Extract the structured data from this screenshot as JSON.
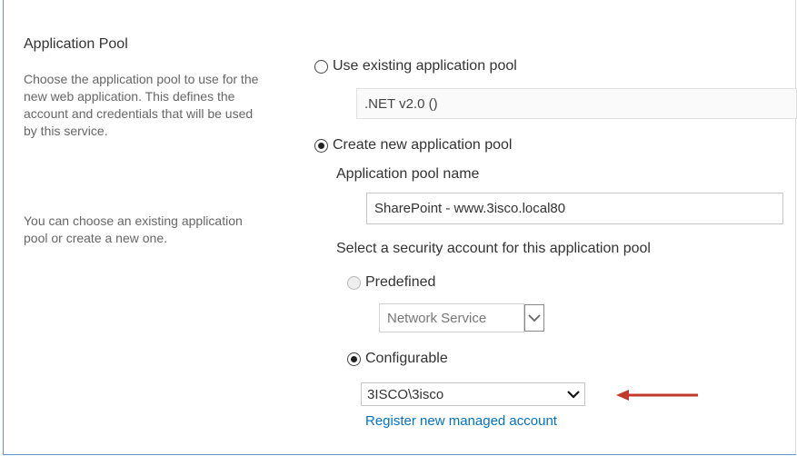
{
  "section": {
    "title": "Application Pool",
    "description_1": "Choose the application pool to use for the new web application. This defines the account and credentials that will be used by this service.",
    "description_2": "You can choose an existing application pool or create a new one."
  },
  "existing": {
    "label": "Use existing application pool",
    "value": ".NET v2.0 ()"
  },
  "create_new": {
    "label": "Create new application pool",
    "name_label": "Application pool name",
    "name_value": "SharePoint - www.3isco.local80"
  },
  "security": {
    "prompt": "Select a security account for this application pool",
    "predefined_label": "Predefined",
    "predefined_value": "Network Service",
    "configurable_label": "Configurable",
    "configurable_value": "3ISCO\\3isco",
    "register_link": "Register new managed account"
  },
  "colors": {
    "arrow": "#c0392b",
    "link": "#0072c6",
    "frame_border": "#6b8fc6"
  }
}
